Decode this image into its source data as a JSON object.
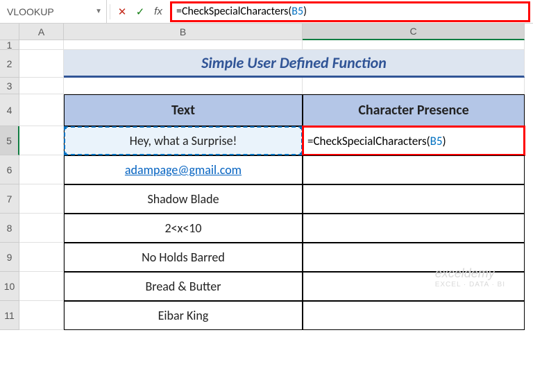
{
  "nameBox": "VLOOKUP",
  "formulaBar": {
    "prefix": "=CheckSpecialCharacters(",
    "ref": "B5",
    "suffix": ")"
  },
  "columns": [
    "A",
    "B",
    "C"
  ],
  "rows": [
    "1",
    "2",
    "3",
    "4",
    "5",
    "6",
    "7",
    "8",
    "9",
    "10",
    "11"
  ],
  "title": "Simple User Defined Function",
  "headers": {
    "text": "Text",
    "presence": "Character Presence"
  },
  "data": [
    {
      "text": "Hey, what a Surprise!",
      "presenceFormula": {
        "prefix": "=CheckSpecialCharacters(",
        "ref": "B5",
        "suffix": ")"
      },
      "link": false
    },
    {
      "text": "adampage@gmail.com",
      "presence": "",
      "link": true
    },
    {
      "text": "Shadow Blade",
      "presence": "",
      "link": false
    },
    {
      "text": "2<x<10",
      "presence": "",
      "link": false
    },
    {
      "text": "No Holds Barred",
      "presence": "",
      "link": false
    },
    {
      "text": "Bread & Butter",
      "presence": "",
      "link": false
    },
    {
      "text": "Eibar King",
      "presence": "",
      "link": false
    }
  ],
  "watermark": {
    "main": "exceldemy",
    "sub": "EXCEL · DATA · BI"
  },
  "chart_data": null
}
